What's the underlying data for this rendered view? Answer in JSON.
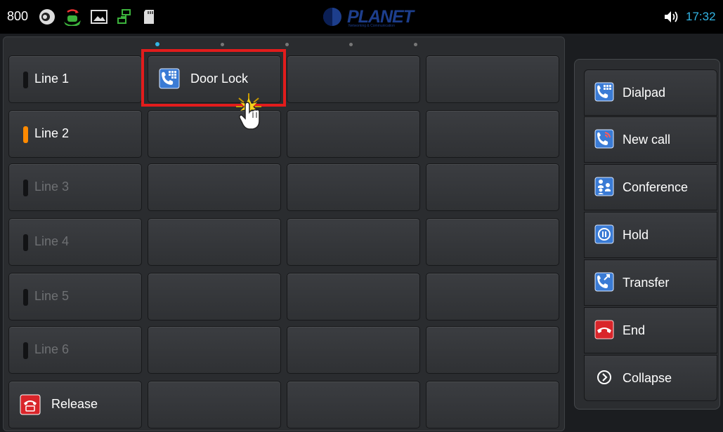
{
  "statusbar": {
    "extension": "800",
    "logo_text": "PLANET",
    "logo_sub": "Networking & Communication",
    "time": "17:32"
  },
  "pages": {
    "count": 5,
    "active": 0
  },
  "lines": [
    {
      "label": "Line 1",
      "state": "idle",
      "enabled": true
    },
    {
      "label": "Line 2",
      "state": "active",
      "enabled": true
    },
    {
      "label": "Line 3",
      "state": "idle",
      "enabled": false
    },
    {
      "label": "Line 4",
      "state": "idle",
      "enabled": false
    },
    {
      "label": "Line 5",
      "state": "idle",
      "enabled": false
    },
    {
      "label": "Line 6",
      "state": "idle",
      "enabled": false
    }
  ],
  "release": {
    "label": "Release"
  },
  "speed_dial": {
    "door_lock": {
      "label": "Door Lock"
    }
  },
  "side_menu": [
    {
      "label": "Dialpad",
      "icon": "dialpad-icon"
    },
    {
      "label": "New call",
      "icon": "new-call-icon"
    },
    {
      "label": "Conference",
      "icon": "conference-icon"
    },
    {
      "label": "Hold",
      "icon": "hold-icon"
    },
    {
      "label": "Transfer",
      "icon": "transfer-icon"
    },
    {
      "label": "End",
      "icon": "end-call-icon"
    },
    {
      "label": "Collapse",
      "icon": "collapse-icon"
    }
  ],
  "colors": {
    "accent": "#33b5e5",
    "line_active": "#ff8a00",
    "highlight": "#e21c1c",
    "end": "#d9252a"
  }
}
